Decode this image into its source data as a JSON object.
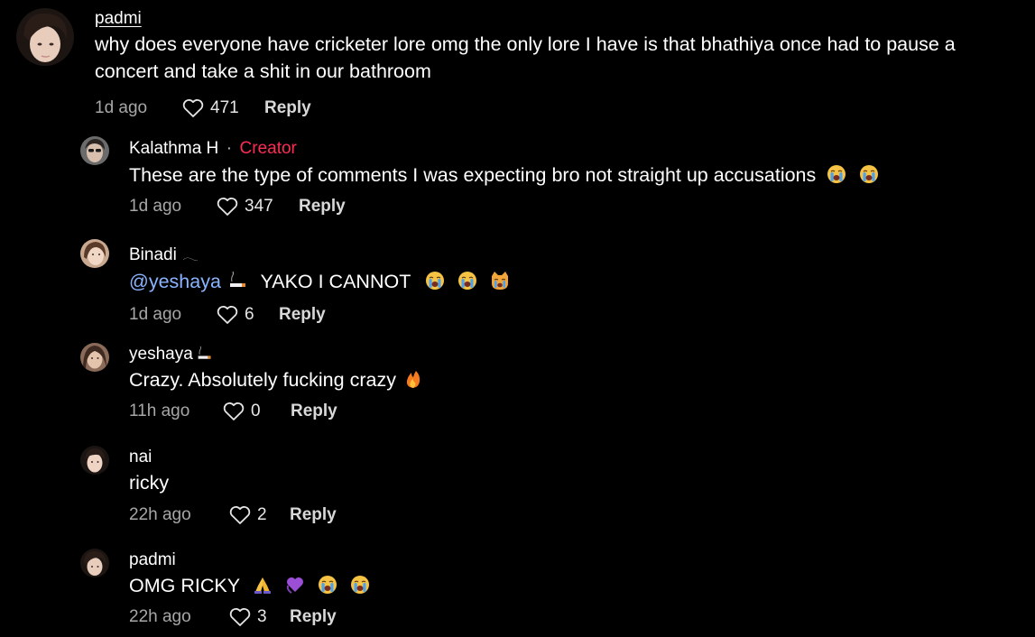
{
  "comments": [
    {
      "username": "padmi",
      "text": "why does everyone have cricketer lore omg the only lore I have is that bhathiya once had to pause a concert and take a shit in our bathroom",
      "time": "1d ago",
      "likes": "471",
      "reply_label": "Reply",
      "avatar_icon": "user-avatar-icon"
    },
    {
      "username": "Kalathma H",
      "separator": "·",
      "badge": "Creator",
      "text": "These are the type of comments I was expecting bro not straight up accusations",
      "emojis": [
        "loudly-crying-face-icon",
        "loudly-crying-face-icon"
      ],
      "time": "1d ago",
      "likes": "347",
      "reply_label": "Reply"
    },
    {
      "username": "Binadi",
      "username_emoji": "𓂃",
      "mention": "@yeshaya",
      "text": "YAKO I CANNOT",
      "emojis": [
        "loudly-crying-face-icon",
        "loudly-crying-face-icon",
        "crying-cat-face-icon"
      ],
      "time": "1d ago",
      "likes": "6",
      "reply_label": "Reply"
    },
    {
      "username": "yeshaya",
      "text": "Crazy. Absolutely fucking crazy",
      "emojis": [
        "fire-icon"
      ],
      "time": "11h ago",
      "likes": "0",
      "reply_label": "Reply"
    },
    {
      "username": "nai",
      "text": "ricky",
      "time": "22h ago",
      "likes": "2",
      "reply_label": "Reply"
    },
    {
      "username": "padmi",
      "text": "OMG RICKY",
      "emojis": [
        "folded-hands-icon",
        "purple-heart-hands-icon",
        "loudly-crying-face-icon",
        "loudly-crying-face-icon"
      ],
      "time": "22h ago",
      "likes": "3",
      "reply_label": "Reply"
    }
  ],
  "colors": {
    "background": "#000000",
    "creator_badge": "#fe2c55",
    "mention": "#8ab4ff",
    "meta_text": "#a7a7a7"
  }
}
